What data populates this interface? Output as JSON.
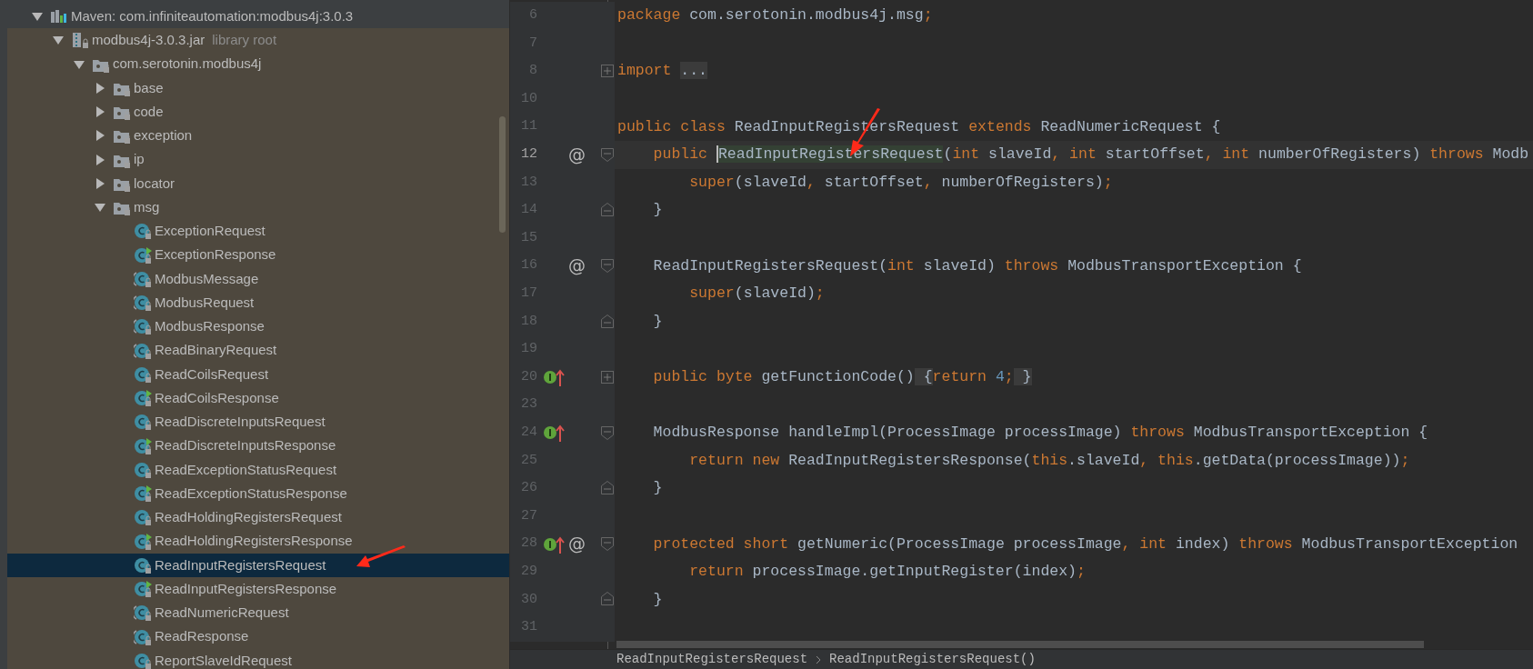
{
  "project_tree": [
    {
      "label": "Maven: com.infiniteautomation:modbus4j:3.0.3",
      "kind": "module",
      "expanded": true,
      "selected": false,
      "children": [
        {
          "label": "modbus4j-3.0.3.jar",
          "hint": "library root",
          "kind": "jar",
          "expanded": true,
          "selected": false,
          "children": [
            {
              "label": "com.serotonin.modbus4j",
              "kind": "package",
              "expanded": true,
              "selected": false,
              "children": [
                {
                  "label": "base",
                  "kind": "package",
                  "expanded": false,
                  "selected": false
                },
                {
                  "label": "code",
                  "kind": "package",
                  "expanded": false,
                  "selected": false
                },
                {
                  "label": "exception",
                  "kind": "package",
                  "expanded": false,
                  "selected": false
                },
                {
                  "label": "ip",
                  "kind": "package",
                  "expanded": false,
                  "selected": false
                },
                {
                  "label": "locator",
                  "kind": "package",
                  "expanded": false,
                  "selected": false
                },
                {
                  "label": "msg",
                  "kind": "package",
                  "expanded": true,
                  "selected": false,
                  "children": [
                    {
                      "label": "ExceptionRequest",
                      "kind": "class",
                      "selected": false
                    },
                    {
                      "label": "ExceptionResponse",
                      "kind": "runnable",
                      "selected": false
                    },
                    {
                      "label": "ModbusMessage",
                      "kind": "abstract",
                      "selected": false
                    },
                    {
                      "label": "ModbusRequest",
                      "kind": "abstract",
                      "selected": false
                    },
                    {
                      "label": "ModbusResponse",
                      "kind": "abstract",
                      "selected": false
                    },
                    {
                      "label": "ReadBinaryRequest",
                      "kind": "abstract",
                      "selected": false
                    },
                    {
                      "label": "ReadCoilsRequest",
                      "kind": "class",
                      "selected": false
                    },
                    {
                      "label": "ReadCoilsResponse",
                      "kind": "runnable",
                      "selected": false
                    },
                    {
                      "label": "ReadDiscreteInputsRequest",
                      "kind": "class",
                      "selected": false
                    },
                    {
                      "label": "ReadDiscreteInputsResponse",
                      "kind": "runnable",
                      "selected": false
                    },
                    {
                      "label": "ReadExceptionStatusRequest",
                      "kind": "class",
                      "selected": false
                    },
                    {
                      "label": "ReadExceptionStatusResponse",
                      "kind": "runnable",
                      "selected": false
                    },
                    {
                      "label": "ReadHoldingRegistersRequest",
                      "kind": "class",
                      "selected": false
                    },
                    {
                      "label": "ReadHoldingRegistersResponse",
                      "kind": "runnable",
                      "selected": false
                    },
                    {
                      "label": "ReadInputRegistersRequest",
                      "kind": "class",
                      "selected": true
                    },
                    {
                      "label": "ReadInputRegistersResponse",
                      "kind": "runnable",
                      "selected": false
                    },
                    {
                      "label": "ReadNumericRequest",
                      "kind": "abstract",
                      "selected": false
                    },
                    {
                      "label": "ReadResponse",
                      "kind": "abstract",
                      "selected": false
                    },
                    {
                      "label": "ReportSlaveIdRequest",
                      "kind": "class",
                      "selected": false
                    }
                  ]
                }
              ]
            }
          ]
        }
      ]
    }
  ],
  "editor": {
    "lines": [
      {
        "number": "6",
        "tokens": [
          {
            "t": "package",
            "kind": "kw"
          },
          {
            "t": " com.serotonin.modbus4j.msg",
            "kind": "plain"
          },
          {
            "t": ";",
            "kind": "kw"
          }
        ]
      },
      {
        "number": "7"
      },
      {
        "number": "8",
        "fold": {
          "kind": "expand"
        },
        "tokens": [
          {
            "t": "import ",
            "kind": "kw"
          },
          {
            "t": "...",
            "kind": "folded"
          }
        ]
      },
      {
        "number": "10"
      },
      {
        "number": "11",
        "tokens": [
          {
            "t": "public class",
            "kind": "kw"
          },
          {
            "t": " ReadInputRegistersRequest ",
            "kind": "plain"
          },
          {
            "t": "extends",
            "kind": "kw"
          },
          {
            "t": " ReadNumericRequest {",
            "kind": "plain"
          }
        ]
      },
      {
        "number": "12",
        "current": true,
        "annotation": "@",
        "fold": {
          "kind": "start"
        },
        "tokens": [
          {
            "t": "    public ",
            "kind": "kw"
          },
          {
            "t": "ReadInputRegistersRequest",
            "kind": "usage"
          },
          {
            "t": "(",
            "kind": "plain"
          },
          {
            "t": "int",
            "kind": "kw"
          },
          {
            "t": " slaveId",
            "kind": "plain"
          },
          {
            "t": ", int",
            "kind": "kw"
          },
          {
            "t": " startOffset",
            "kind": "plain"
          },
          {
            "t": ", int",
            "kind": "kw"
          },
          {
            "t": " numberOfRegisters) ",
            "kind": "plain"
          },
          {
            "t": "throws",
            "kind": "kw"
          },
          {
            "t": " Modb",
            "kind": "plain"
          }
        ]
      },
      {
        "number": "13",
        "tokens": [
          {
            "t": "        super",
            "kind": "kw"
          },
          {
            "t": "(slaveId",
            "kind": "plain"
          },
          {
            "t": ",",
            "kind": "kw"
          },
          {
            "t": " startOffset",
            "kind": "plain"
          },
          {
            "t": ",",
            "kind": "kw"
          },
          {
            "t": " numberOfRegisters)",
            "kind": "plain"
          },
          {
            "t": ";",
            "kind": "kw"
          }
        ]
      },
      {
        "number": "14",
        "fold": {
          "kind": "end"
        },
        "tokens": [
          {
            "t": "    }",
            "kind": "plain"
          }
        ]
      },
      {
        "number": "15"
      },
      {
        "number": "16",
        "annotation": "@",
        "fold": {
          "kind": "start"
        },
        "tokens": [
          {
            "t": "    ReadInputRegistersRequest(",
            "kind": "plain"
          },
          {
            "t": "int",
            "kind": "kw"
          },
          {
            "t": " slaveId) ",
            "kind": "plain"
          },
          {
            "t": "throws",
            "kind": "kw"
          },
          {
            "t": " ModbusTransportException {",
            "kind": "plain"
          }
        ]
      },
      {
        "number": "17",
        "tokens": [
          {
            "t": "        super",
            "kind": "kw"
          },
          {
            "t": "(slaveId)",
            "kind": "plain"
          },
          {
            "t": ";",
            "kind": "kw"
          }
        ]
      },
      {
        "number": "18",
        "fold": {
          "kind": "end"
        },
        "tokens": [
          {
            "t": "    }",
            "kind": "plain"
          }
        ]
      },
      {
        "number": "19"
      },
      {
        "number": "20",
        "implements": true,
        "fold": {
          "kind": "expand"
        },
        "tokens": [
          {
            "t": "    public byte",
            "kind": "kw"
          },
          {
            "t": " getFunctionCode()",
            "kind": "plain"
          },
          {
            "t": " {",
            "kind": "folded"
          },
          {
            "t": "return ",
            "kind": "kw"
          },
          {
            "t": "4",
            "kind": "num"
          },
          {
            "t": ";",
            "kind": "kw"
          },
          {
            "t": " }",
            "kind": "folded"
          }
        ]
      },
      {
        "number": "23"
      },
      {
        "number": "24",
        "implements": true,
        "fold": {
          "kind": "start"
        },
        "tokens": [
          {
            "t": "    ModbusResponse handleImpl(ProcessImage processImage) ",
            "kind": "plain"
          },
          {
            "t": "throws",
            "kind": "kw"
          },
          {
            "t": " ModbusTransportException {",
            "kind": "plain"
          }
        ]
      },
      {
        "number": "25",
        "tokens": [
          {
            "t": "        return new",
            "kind": "kw"
          },
          {
            "t": " ReadInputRegistersResponse(",
            "kind": "plain"
          },
          {
            "t": "this",
            "kind": "kw"
          },
          {
            "t": ".slaveId",
            "kind": "plain"
          },
          {
            "t": ", this",
            "kind": "kw"
          },
          {
            "t": ".getData(processImage))",
            "kind": "plain"
          },
          {
            "t": ";",
            "kind": "kw"
          }
        ]
      },
      {
        "number": "26",
        "fold": {
          "kind": "end"
        },
        "tokens": [
          {
            "t": "    }",
            "kind": "plain"
          }
        ]
      },
      {
        "number": "27"
      },
      {
        "number": "28",
        "implements": true,
        "annotation": "@",
        "fold": {
          "kind": "start"
        },
        "tokens": [
          {
            "t": "    protected short",
            "kind": "kw"
          },
          {
            "t": " getNumeric(ProcessImage processImage",
            "kind": "plain"
          },
          {
            "t": ", int",
            "kind": "kw"
          },
          {
            "t": " index) ",
            "kind": "plain"
          },
          {
            "t": "throws",
            "kind": "kw"
          },
          {
            "t": " ModbusTransportException",
            "kind": "plain"
          }
        ]
      },
      {
        "number": "29",
        "tokens": [
          {
            "t": "        return",
            "kind": "kw"
          },
          {
            "t": " processImage.getInputRegister(index)",
            "kind": "plain"
          },
          {
            "t": ";",
            "kind": "kw"
          }
        ]
      },
      {
        "number": "30",
        "fold": {
          "kind": "end"
        },
        "tokens": [
          {
            "t": "    }",
            "kind": "plain"
          }
        ]
      },
      {
        "number": "31"
      }
    ],
    "breadcrumbs": [
      "ReadInputRegistersRequest",
      "ReadInputRegistersRequest()"
    ]
  }
}
